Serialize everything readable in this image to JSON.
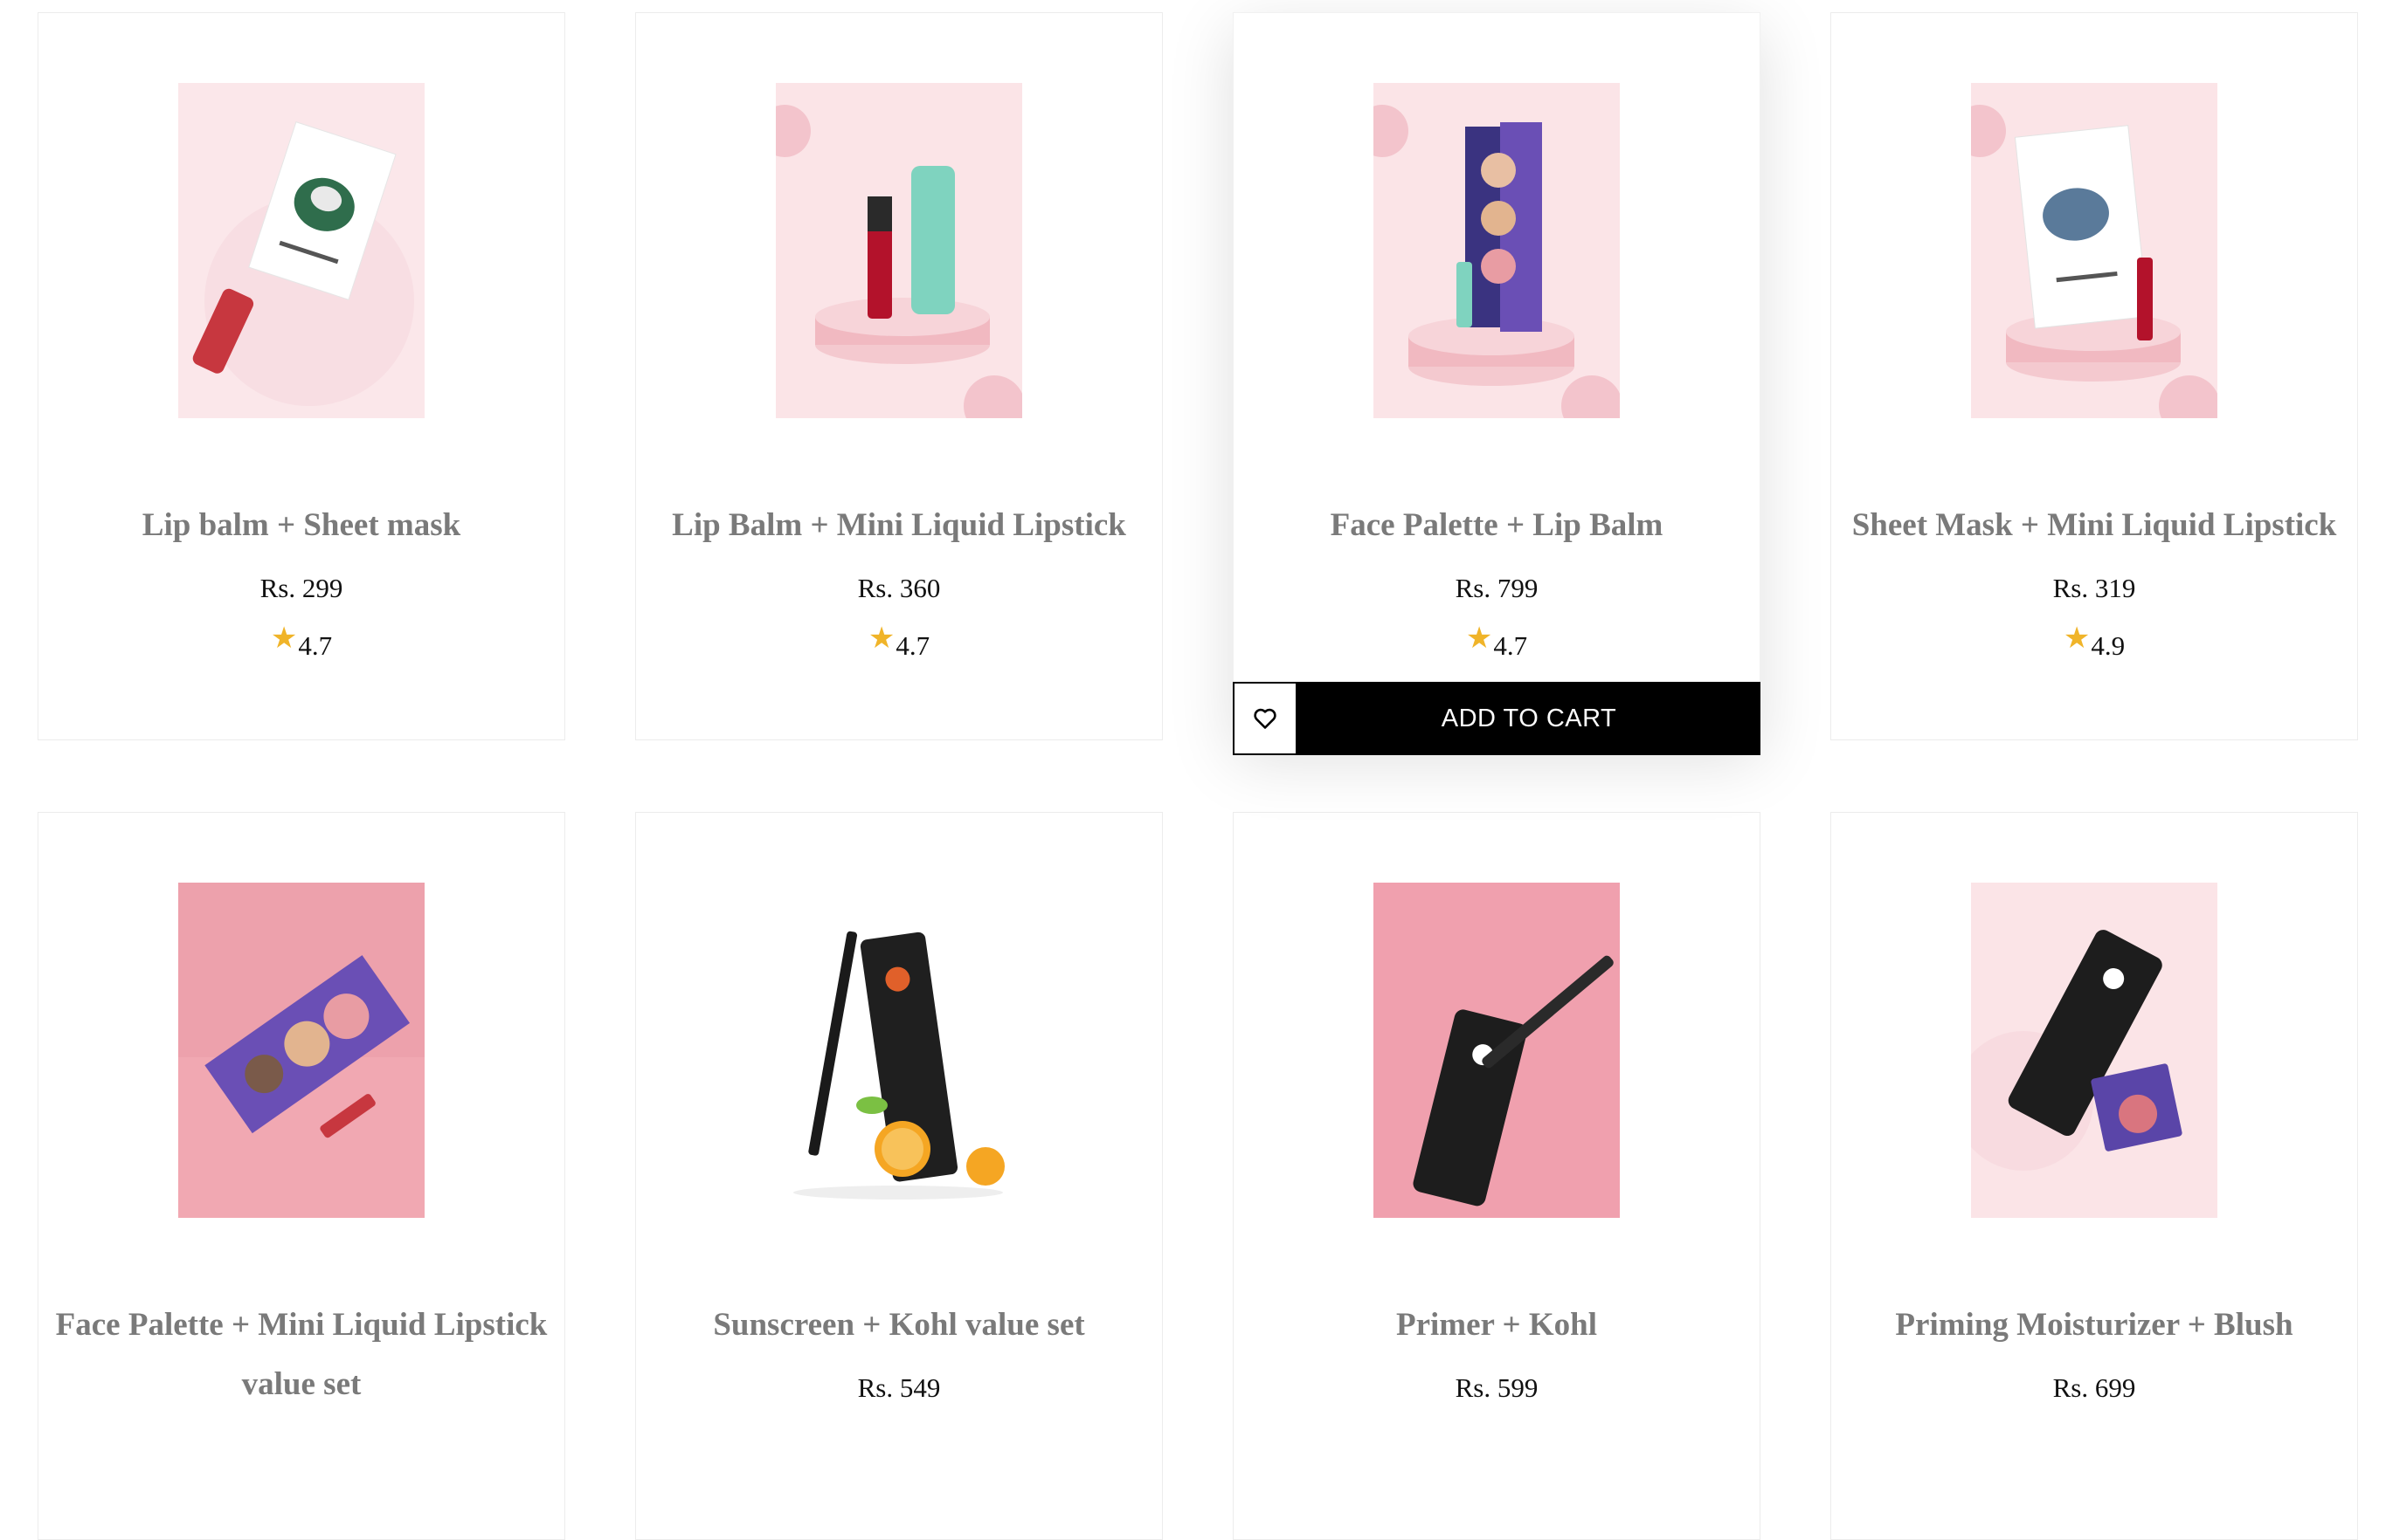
{
  "products": [
    {
      "name": "Lip balm + Sheet mask",
      "price": "Rs. 299",
      "rating": "4.7"
    },
    {
      "name": "Lip Balm + Mini Liquid Lipstick",
      "price": "Rs. 360",
      "rating": "4.7"
    },
    {
      "name": "Face Palette + Lip Balm",
      "price": "Rs. 799",
      "rating": "4.7"
    },
    {
      "name": "Sheet Mask + Mini Liquid Lipstick",
      "price": "Rs. 319",
      "rating": "4.9"
    },
    {
      "name": "Face Palette + Mini Liquid Lipstick value set",
      "price": "",
      "rating": ""
    },
    {
      "name": "Sunscreen + Kohl value set",
      "price": "Rs. 549",
      "rating": ""
    },
    {
      "name": "Primer + Kohl",
      "price": "Rs. 599",
      "rating": ""
    },
    {
      "name": "Priming Moisturizer + Blush",
      "price": "Rs. 699",
      "rating": ""
    }
  ],
  "hover_actions": {
    "add_to_cart_label": "ADD TO CART",
    "wishlist_icon": "heart-icon"
  },
  "icons": {
    "rating": "star-icon"
  },
  "colors": {
    "title": "#7a7a7a",
    "star": "#f0b429",
    "cart_bg": "#000000",
    "cart_text": "#ffffff"
  }
}
